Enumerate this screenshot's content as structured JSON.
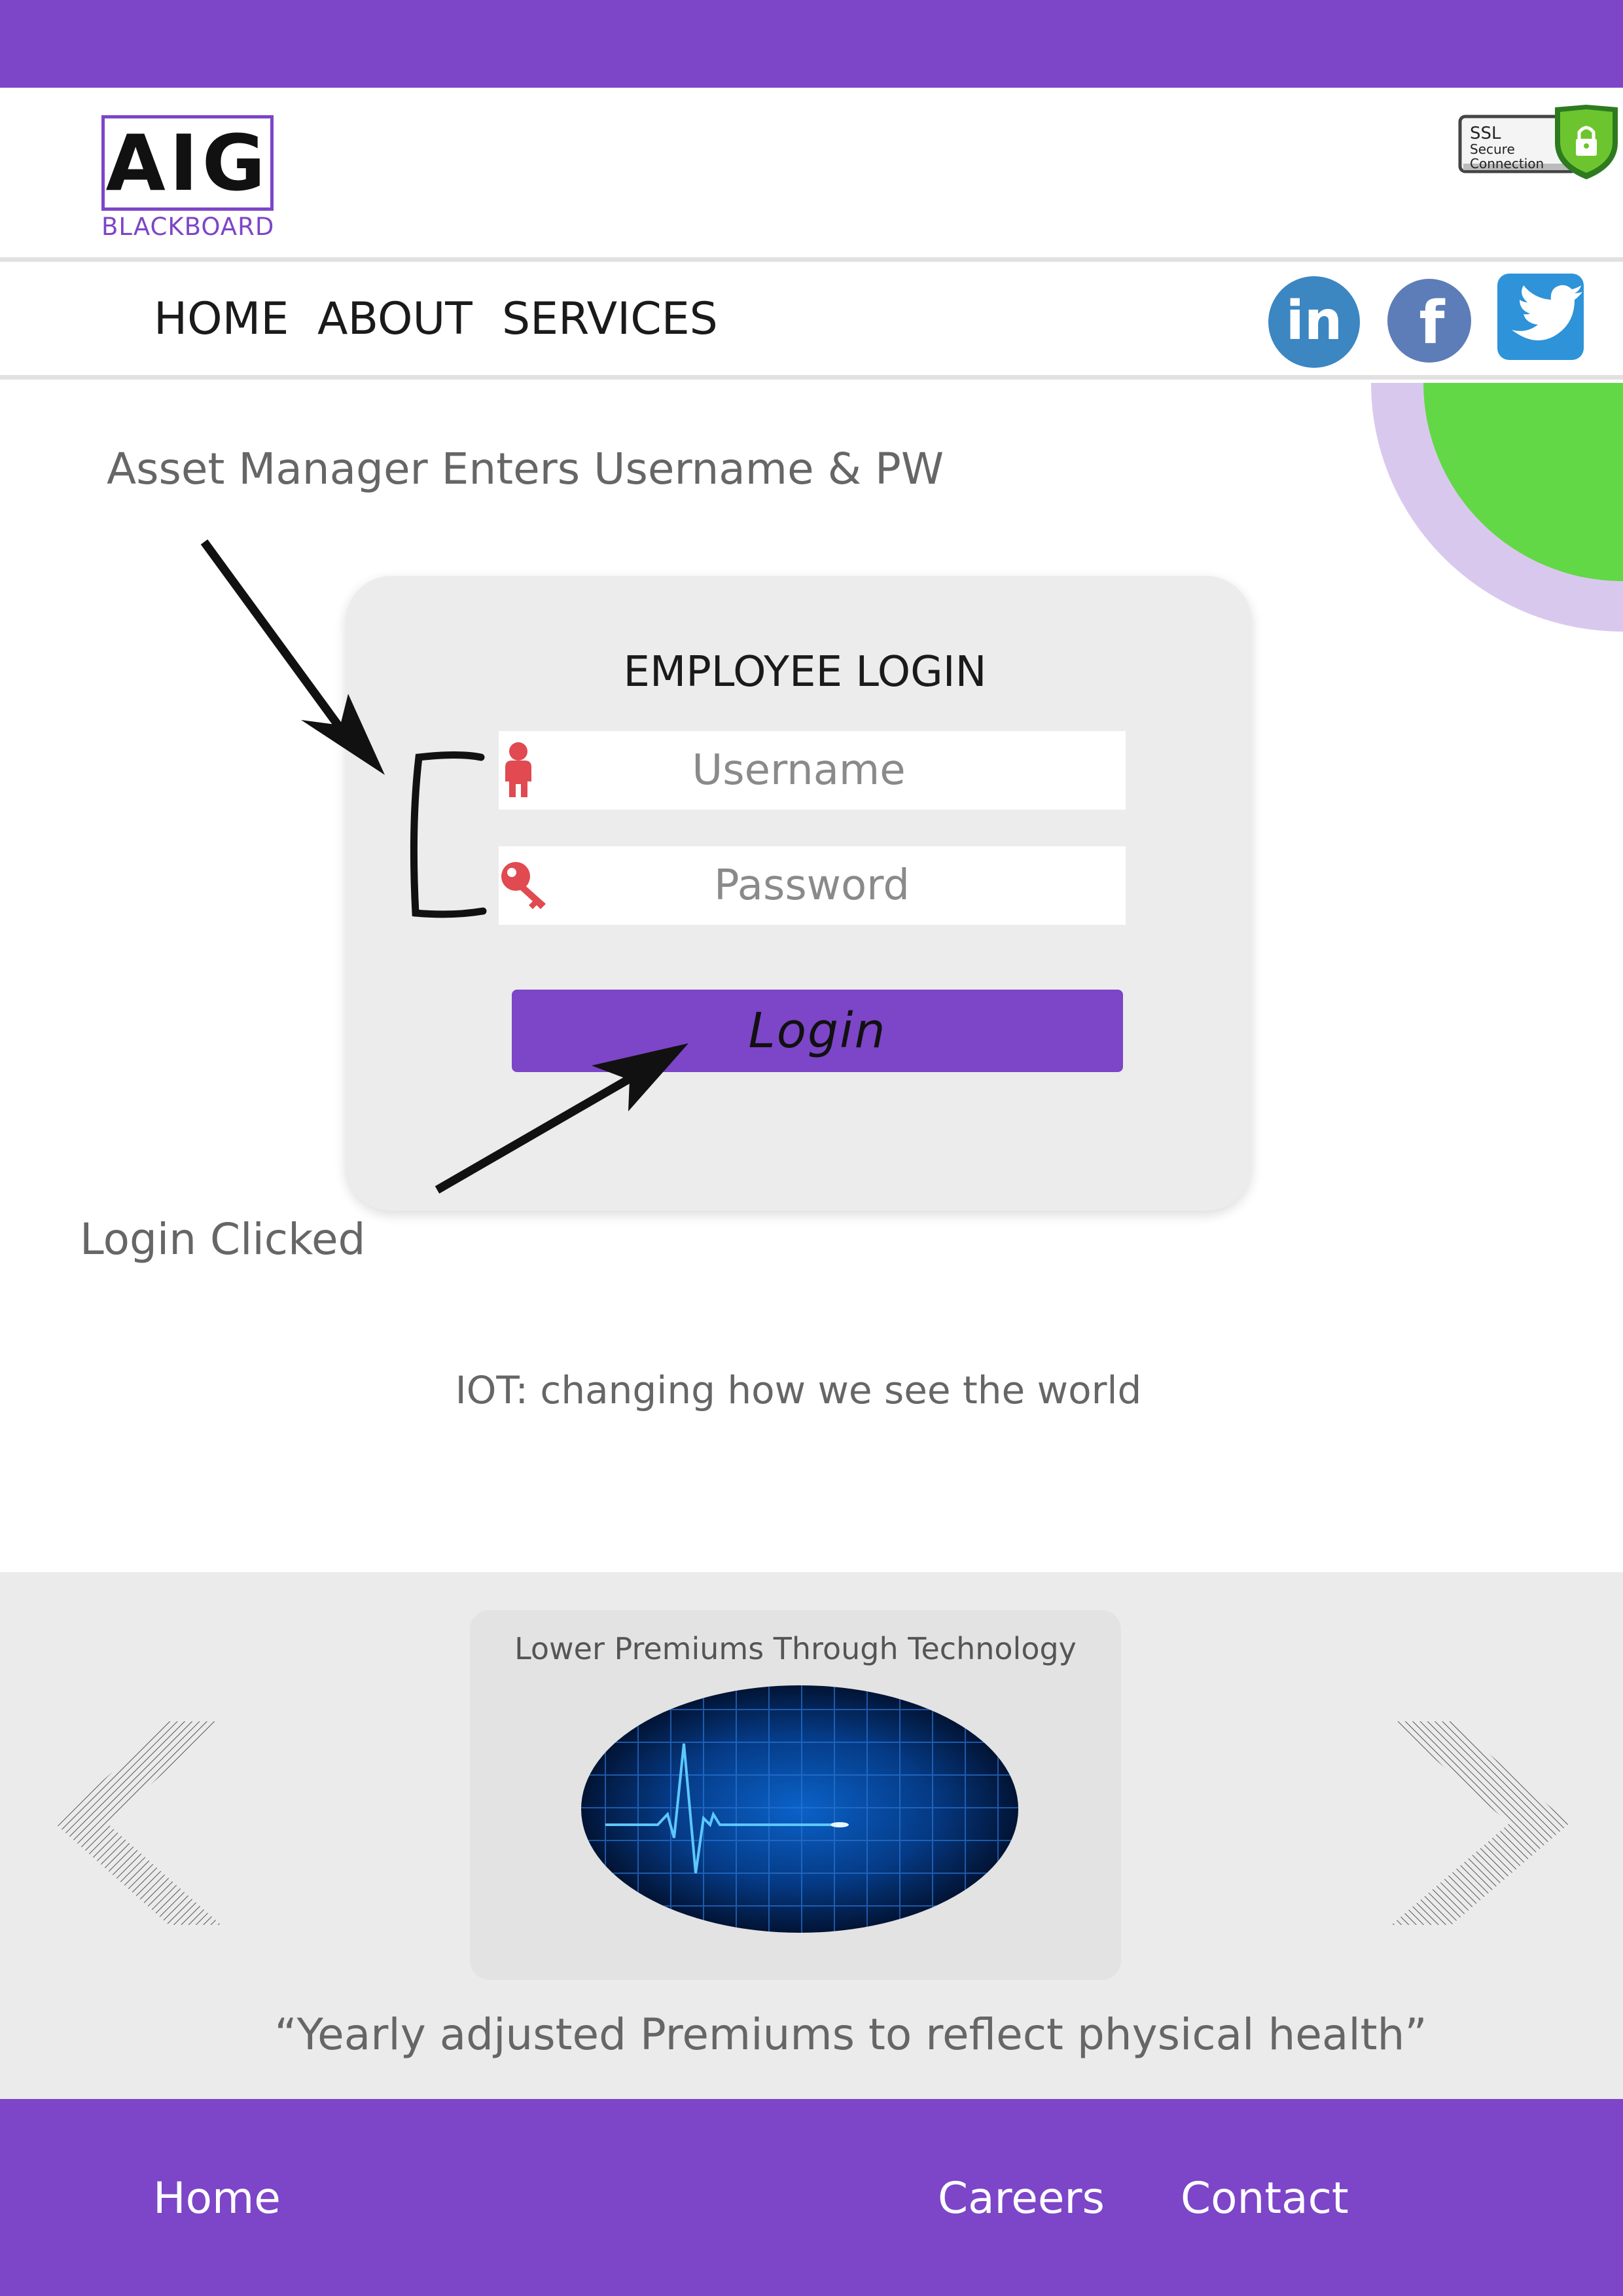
{
  "brand": {
    "logo_text": "AIG",
    "logo_subtitle": "BLACKBOARD",
    "accent_color": "#7d45c8"
  },
  "header": {
    "ssl_badge": {
      "line1": "SSL",
      "line2": "Secure",
      "line3": "Connection",
      "icon": "shield-lock-icon"
    }
  },
  "nav": {
    "items": [
      {
        "label": "HOME"
      },
      {
        "label": "ABOUT"
      },
      {
        "label": "SERVICES"
      }
    ],
    "social": [
      {
        "icon": "linkedin-icon",
        "glyph": "in"
      },
      {
        "icon": "facebook-icon",
        "glyph": "f"
      },
      {
        "icon": "twitter-icon"
      }
    ]
  },
  "annotations": {
    "top": "Asset Manager Enters Username & PW",
    "bottom": "Login Clicked"
  },
  "login": {
    "title": "EMPLOYEE LOGIN",
    "username_placeholder": "Username",
    "password_placeholder": "Password",
    "button_label": "Login",
    "username_icon": "user-icon",
    "password_icon": "key-icon"
  },
  "tagline": "IOT: changing how we see the world",
  "carousel": {
    "slide_title": "Lower Premiums Through Technology",
    "slide_image": "heartbeat-monitor-image",
    "prev_icon": "chevron-left-icon",
    "next_icon": "chevron-right-icon",
    "quote": "“Yearly adjusted Premiums to reflect physical health”"
  },
  "footer": {
    "links": [
      {
        "label": "Home"
      },
      {
        "label": "Careers"
      },
      {
        "label": "Contact"
      }
    ]
  }
}
